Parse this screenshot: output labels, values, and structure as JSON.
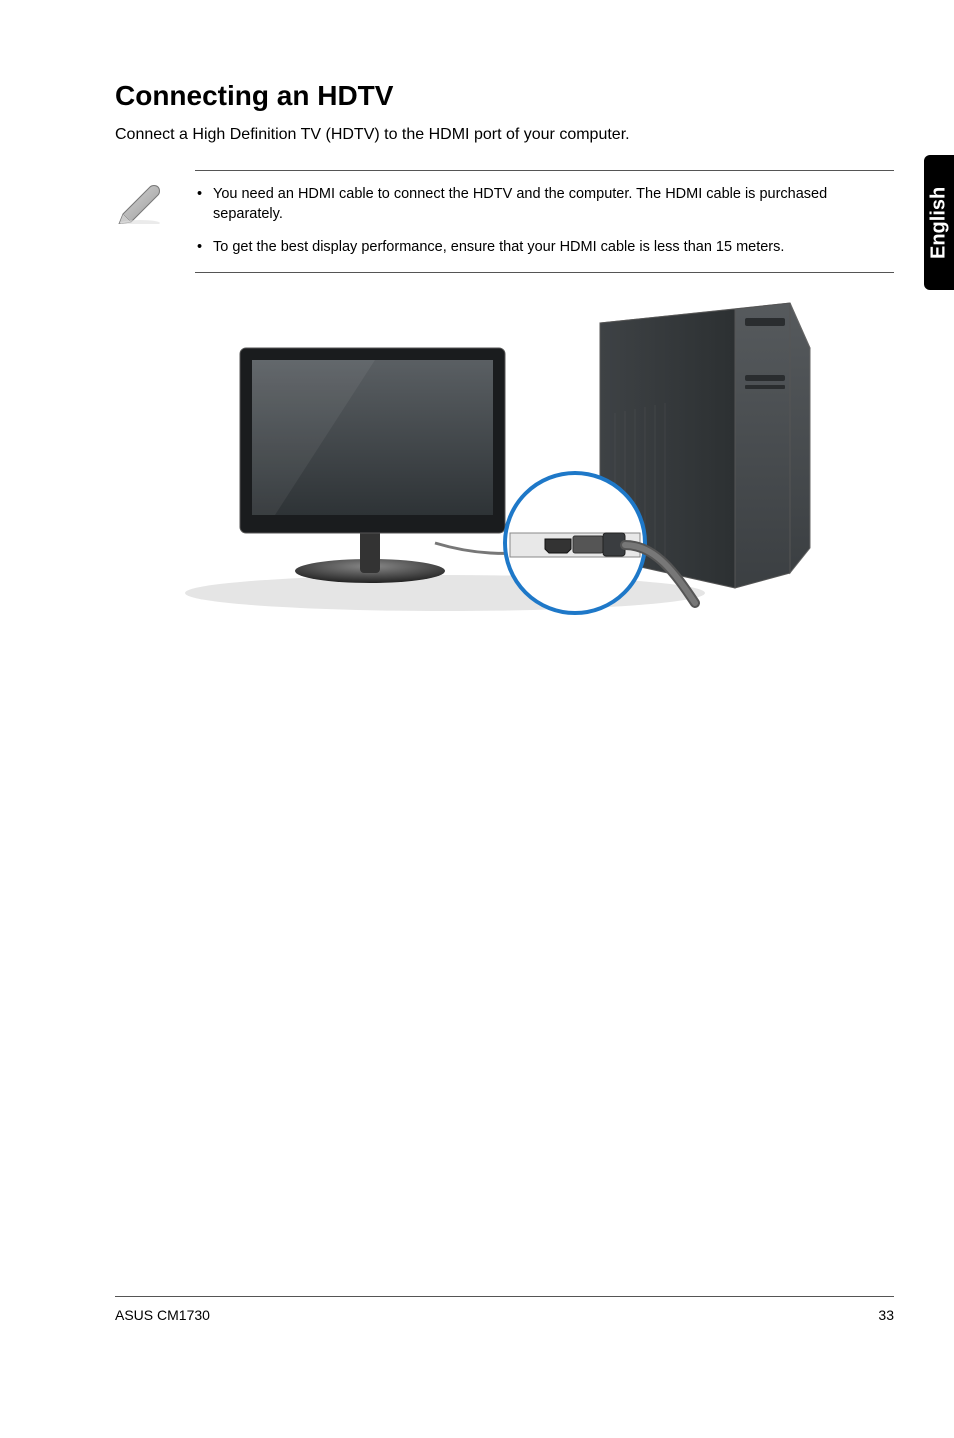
{
  "sideTab": "English",
  "heading": "Connecting an HDTV",
  "intro": "Connect a High Definition TV (HDTV) to the HDMI port of your computer.",
  "notes": [
    "You need an HDMI cable to connect the HDTV and the computer. The HDMI cable is purchased separately.",
    "To get the best display performance, ensure that your HDMI cable is less than 15 meters."
  ],
  "footer": {
    "left": "ASUS CM1730",
    "right": "33"
  }
}
